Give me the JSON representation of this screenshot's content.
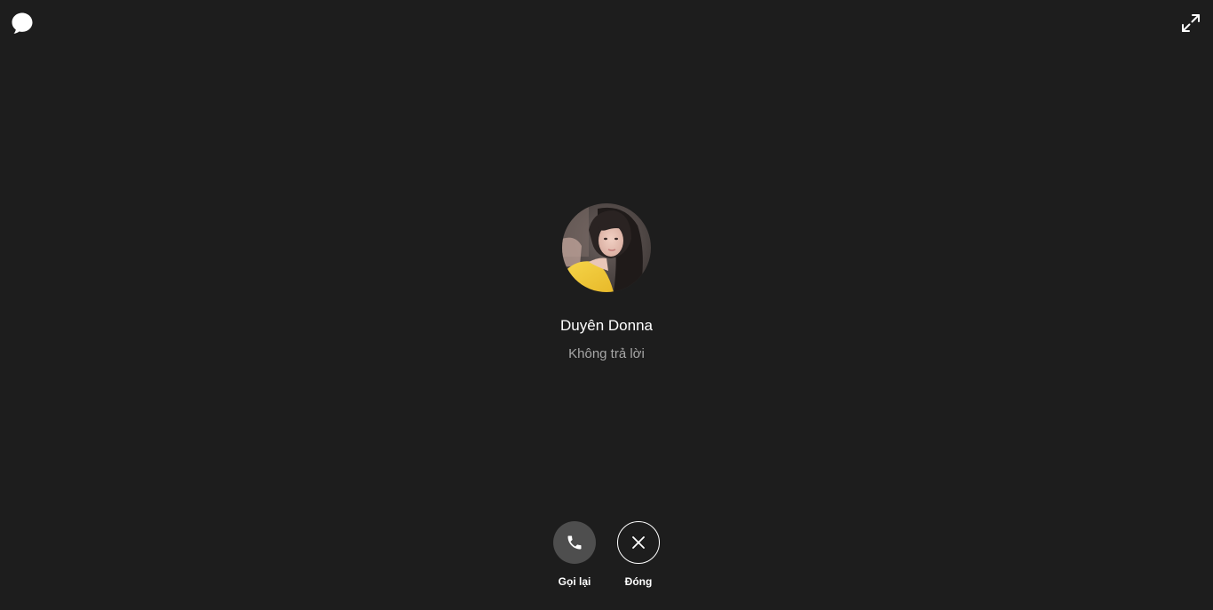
{
  "toolbar": {
    "chat_icon": "chat-bubble-icon",
    "expand_icon": "expand-fullscreen-icon"
  },
  "caller": {
    "name": "Duyên Donna",
    "status": "Không trả lời"
  },
  "actions": {
    "redial_label": "Gọi lại",
    "redial_icon": "phone-icon",
    "close_label": "Đóng",
    "close_icon": "close-icon"
  },
  "colors": {
    "background": "#1d1d1d",
    "status_text": "#a7a7a7",
    "redial_button": "#4e4e4e"
  }
}
